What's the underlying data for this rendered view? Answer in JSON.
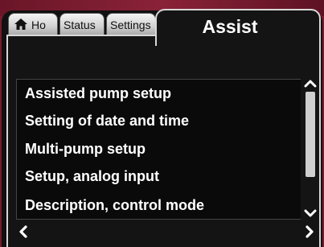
{
  "tabs": {
    "home_label": "Ho",
    "home_icon": "home-icon",
    "status_label": "Status",
    "settings_label": "Settings",
    "active_label": "Assist"
  },
  "assist_menu": {
    "items": [
      "Assisted pump setup",
      "Setting of date and time",
      "Multi-pump setup",
      "Setup, analog input",
      "Description, control mode"
    ]
  },
  "scrollbar": {
    "up_icon": "chevron-up-icon",
    "down_icon": "chevron-down-icon",
    "visible_fraction": 0.73
  },
  "navigation": {
    "left_icon": "chevron-left-icon",
    "right_icon": "chevron-right-icon"
  },
  "colors": {
    "frame_background": "#7a1a2c",
    "screen_background": "#111111",
    "text": "#ffffff",
    "tab_inactive": "#d0d0d0"
  }
}
